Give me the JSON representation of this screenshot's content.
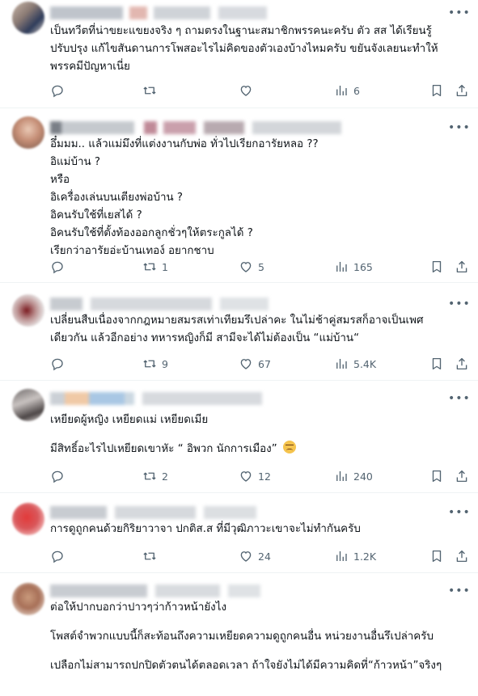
{
  "icons": {
    "reply": "reply-icon",
    "retweet": "retweet-icon",
    "like": "heart-icon",
    "views": "views-icon",
    "bookmark": "bookmark-icon",
    "share": "share-icon",
    "more": "more-icon"
  },
  "colors": {
    "text": "#0f1419",
    "muted": "#536471",
    "divider": "#eff3f4"
  },
  "tweets": [
    {
      "lines": [
        "เป็นทวีตที่น่าขยะแขยงจริง ๆ ถามตรงในฐานะสมาชิกพรรคนะครับ ตัว สส ได้เรียนรู้",
        "ปรับปรุง แก้ไขสันดานการโพสอะไรไม่คิดของตัวเองบ้างไหมครับ ขยันจังเลยนะทำให้",
        "พรรคมีปัญหาเนี่ย"
      ],
      "replies": "",
      "retweets": "",
      "likes": "",
      "views": "6"
    },
    {
      "lines": [
        "อึ๋มมม.. แล้วแม่มึงที่แต่งงานกับพ่อ ทั่วไปเรียกอารัยหลอ ??",
        "อิแม่บ้าน ?",
        "หรือ",
        "อิเครื่องเล่นบนเตียงพ่อบ้าน ?",
        "อิคนรับใช้ที่เยสได้ ?",
        "อิคนรับใช้ที่ตั้งท้องออกลูกชั่วๆให้ตระกูลได้ ?",
        "เรียกว่าอารัยอ่ะบ้านเทอง์ อยากชาบ"
      ],
      "replies": "",
      "retweets": "1",
      "likes": "5",
      "views": "165"
    },
    {
      "lines": [
        "เปลี่ยนสืบเนื่องจากกฎหมายสมรสเท่าเทียมรึเปล่าคะ ในไม่ช้าคู่สมรสก็อาจเป็นเพศ",
        "เดียวกัน แล้วอีกอย่าง ทหารหญิงก็มี สามีจะได้ไม่ต้องเป็น “แม่บ้าน“"
      ],
      "replies": "",
      "retweets": "9",
      "likes": "67",
      "views": "5.4K"
    },
    {
      "lines": [
        "เหยียดผู้หญิง เหยียดแม่ เหยียดเมีย",
        "",
        "มีสิทธิ์อะไรไปเหยียดเขาหัะ “ อิพวก นักการเมือง” "
      ],
      "emoji_name": "angry-face-emoji",
      "replies": "",
      "retweets": "2",
      "likes": "12",
      "views": "240"
    },
    {
      "lines": [
        "การดูถูกคนด้วยกิริยาวาจา ปกติส.ส ที่มีวุฒิภาวะเขาจะไม่ทำกันครับ"
      ],
      "replies": "",
      "retweets": "",
      "likes": "24",
      "views": "1.2K"
    },
    {
      "lines": [
        "ต่อให้ปากบอกว่าปาวๆว่าก้าวหน้ายังไง",
        "",
        "โพสต์จำพวกแบบนี้ก็สะท้อนถึงความเหยียดความดูถูกคนอื่น หน่วยงานอื่นรึเปล่าครับ",
        "",
        "เปลือกไม่สามารถปกปิดตัวตนได้ตลอดเวลา ถ้าใจยังไม่ได้มีความคิดที่“ก้าวหน้า”จริงๆ"
      ]
    }
  ]
}
